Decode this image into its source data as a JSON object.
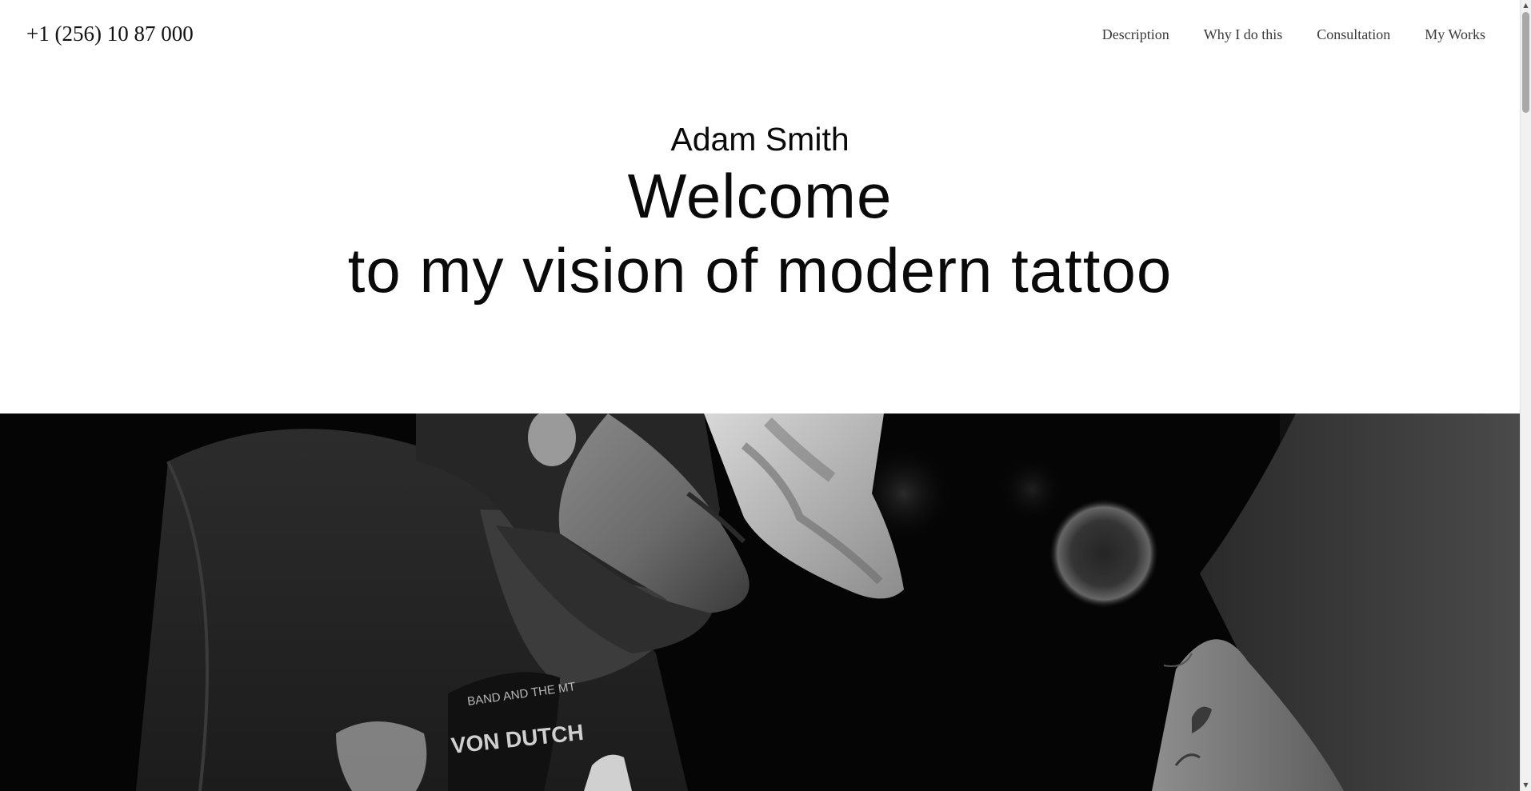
{
  "header": {
    "phone": "+1 (256) 10 87 000",
    "nav": [
      {
        "label": "Description"
      },
      {
        "label": "Why I do this"
      },
      {
        "label": "Consultation"
      },
      {
        "label": "My Works"
      }
    ]
  },
  "hero": {
    "name": "Adam Smith",
    "title": "Welcome",
    "subtitle": "to my vision of modern tattoo"
  },
  "photo": {
    "shirt_print_top": "BAND AND THE MT",
    "shirt_print_main": "VON DUTCH"
  },
  "colors": {
    "background": "#ffffff",
    "text": "#0a0a0a",
    "nav_text": "#3a3a3a",
    "photo_bg": "#050505"
  }
}
